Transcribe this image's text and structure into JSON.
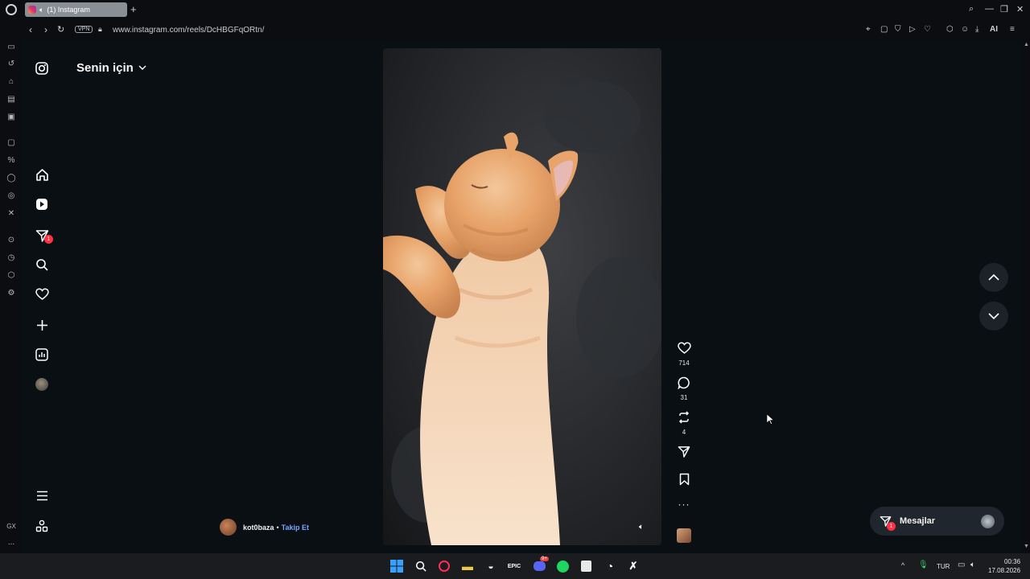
{
  "browser": {
    "tab_title": "(1) Instagram",
    "new_tab_symbol": "+",
    "url": "www.instagram.com/reels/DcHBGFqORtn/",
    "vpn_label": "VPN",
    "ai_label": "AI"
  },
  "instagram": {
    "feed_title": "Senin için",
    "notifications_badge": "1",
    "reel": {
      "author": "kot0baza",
      "separator": "•",
      "follow_label": "Takip Et",
      "likes": "714",
      "comments": "31",
      "reposts": "4"
    },
    "messages": {
      "label": "Mesajlar",
      "badge": "1"
    }
  },
  "opera_sidebar": {
    "gx_label": "GX",
    "more_label": "..."
  },
  "taskbar": {
    "language": "TUR",
    "time": "00:36",
    "date": "17.08.2026",
    "discord_badge": "9+"
  },
  "colors": {
    "accent_link": "#7aa6ff",
    "badge_red": "#ff3040",
    "page_bg": "#0a0f14"
  }
}
